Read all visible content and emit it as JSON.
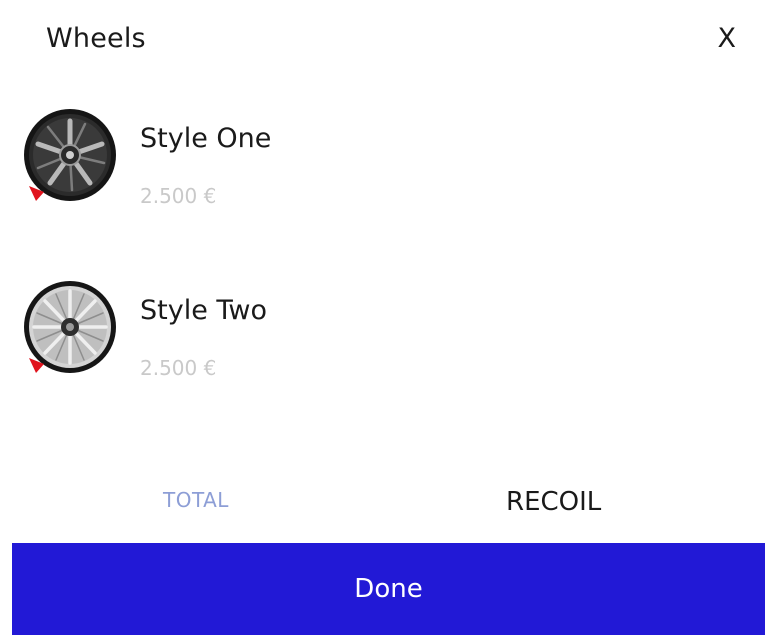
{
  "header": {
    "title": "Wheels",
    "close_label": "X"
  },
  "wheels": [
    {
      "name": "Style One",
      "price": "2.500 €",
      "icon": "dark-alloy-wheel-icon"
    },
    {
      "name": "Style Two",
      "price": "2.500 €",
      "icon": "silver-alloy-wheel-icon"
    }
  ],
  "summary": {
    "total_label": "TOTAL",
    "total_value": "RECOIL"
  },
  "footer": {
    "done_label": "Done"
  },
  "colors": {
    "accent": "#2219d6",
    "price_text": "#c9c9c9",
    "total_label": "#8d9ed6",
    "marker_red": "#e0141e"
  }
}
